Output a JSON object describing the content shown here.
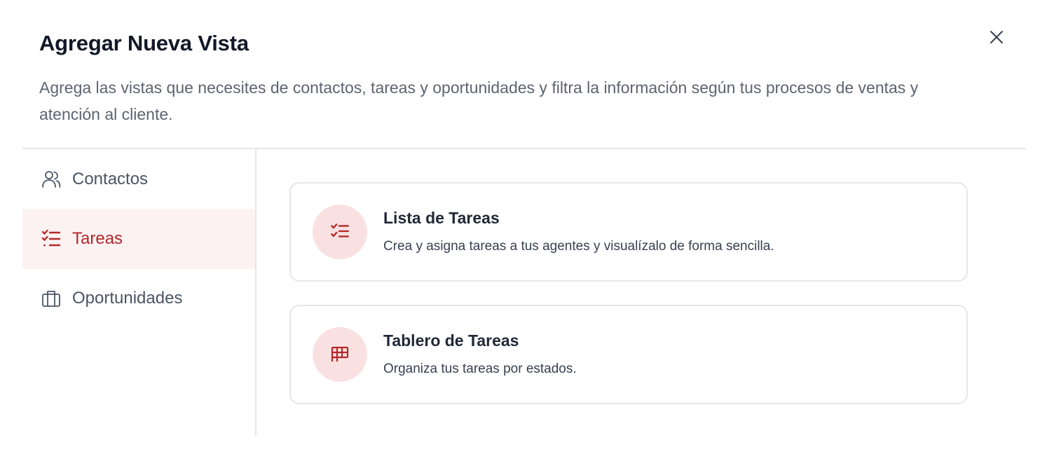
{
  "modal": {
    "title": "Agregar Nueva Vista",
    "description": "Agrega las vistas que necesites de contactos, tareas y oportunidades y filtra la información según tus procesos de ventas y atención al cliente.",
    "close_icon": "close-icon"
  },
  "sidebar": {
    "items": [
      {
        "label": "Contactos",
        "icon": "users-icon",
        "active": false
      },
      {
        "label": "Tareas",
        "icon": "checklist-icon",
        "active": true
      },
      {
        "label": "Oportunidades",
        "icon": "briefcase-icon",
        "active": false
      }
    ]
  },
  "views": [
    {
      "title": "Lista de Tareas",
      "description": "Crea y asigna tareas a tus agentes y visualízalo de forma sencilla.",
      "icon": "checklist-icon"
    },
    {
      "title": "Tablero de Tareas",
      "description": "Organiza tus tareas por estados.",
      "icon": "kanban-board-icon"
    }
  ],
  "colors": {
    "accent": "#b4282b",
    "active_bg": "#fdf2f2",
    "icon_bg": "#fae1e1",
    "border": "#e5e7eb",
    "muted_text": "#5d6470"
  }
}
